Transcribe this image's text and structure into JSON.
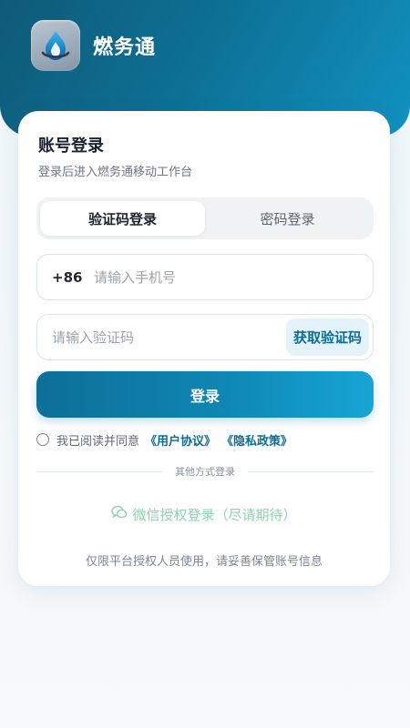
{
  "app": {
    "title": "燃务通",
    "icon": "gas-flame-icon"
  },
  "login": {
    "title": "账号登录",
    "subtitle": "登录后进入燃务通移动工作台",
    "tabs": [
      {
        "label": "验证码登录",
        "active": true
      },
      {
        "label": "密码登录",
        "active": false
      }
    ],
    "phone": {
      "prefix": "+86",
      "placeholder": "请输入手机号"
    },
    "code": {
      "placeholder": "请输入验证码",
      "get_code_label": "获取验证码"
    },
    "submit_label": "登录",
    "agreement": {
      "text": "我已阅读并同意",
      "user_agreement": "《用户协议》",
      "privacy_policy": "《隐私政策》",
      "checked": false
    },
    "other_methods_label": "其他方式登录",
    "wechat_label": "微信授权登录（尽请期待）",
    "footer_note": "仅限平台授权人员使用，请妥善保管账号信息"
  },
  "colors": {
    "brand": "#0d6f93",
    "accent": "#16a5d6",
    "wechat": "#8ed2b0"
  }
}
